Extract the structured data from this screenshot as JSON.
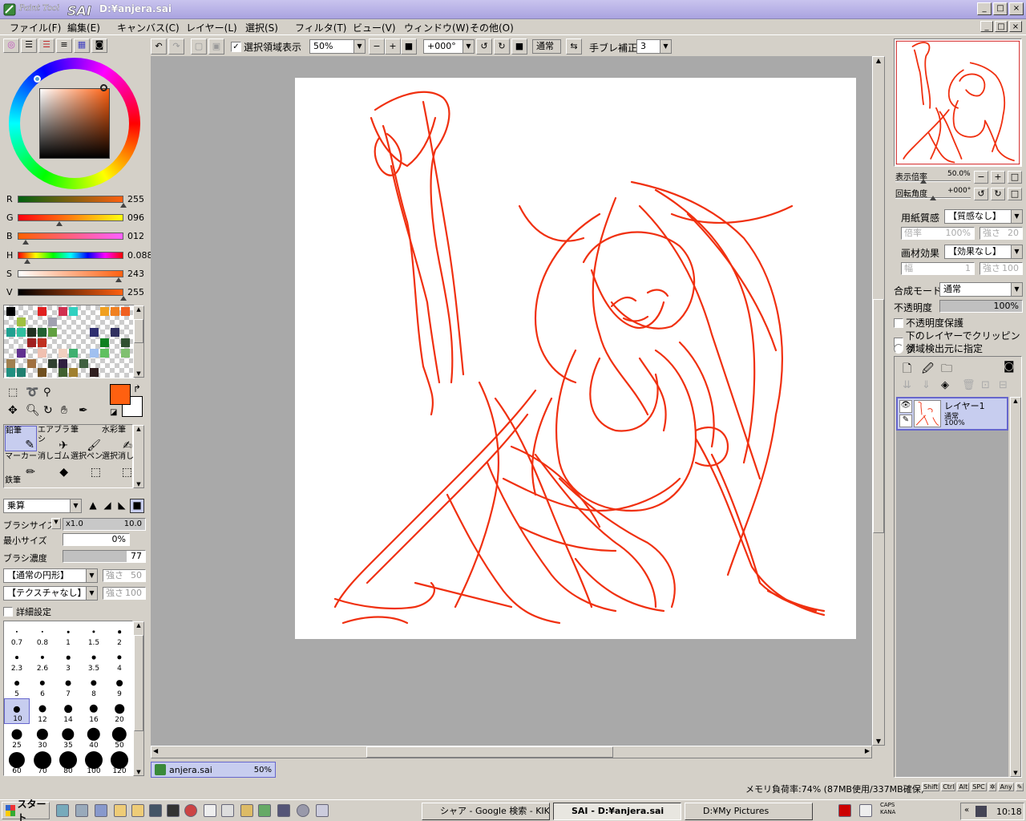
{
  "window": {
    "app_logo": "PaintTool SAI",
    "title": "D:¥anjera.sai"
  },
  "menu": [
    "ファイル(F)",
    "編集(E)",
    "キャンバス(C)",
    "レイヤー(L)",
    "選択(S)",
    "フィルタ(T)",
    "ビュー(V)",
    "ウィンドウ(W)",
    "その他(O)"
  ],
  "toolbar": {
    "selection_show_label": "選択領域表示",
    "selection_show_checked": true,
    "zoom": "50%",
    "rotation": "+000°",
    "blend": "通常",
    "stabilizer_label": "手ブレ補正",
    "stabilizer_value": "3"
  },
  "color": {
    "current_hex": "#ff6010",
    "sliders": [
      {
        "label": "R",
        "value": "255",
        "level": 1.0
      },
      {
        "label": "G",
        "value": "096",
        "level": 0.376
      },
      {
        "label": "B",
        "value": "012",
        "level": 0.047
      },
      {
        "label": "H",
        "value": "0.088",
        "level": 0.06
      },
      {
        "label": "S",
        "value": "243",
        "level": 0.95
      },
      {
        "label": "V",
        "value": "255",
        "level": 1.0
      }
    ]
  },
  "tools": [
    {
      "label": "鉛筆",
      "icon": "pencil-icon",
      "selected": true
    },
    {
      "label": "エアブラシ",
      "icon": "airbrush-icon"
    },
    {
      "label": "筆",
      "icon": "brush-icon"
    },
    {
      "label": "水彩筆",
      "icon": "watercolor-icon"
    },
    {
      "label": "マーカー",
      "icon": "marker-icon"
    },
    {
      "label": "消しゴム",
      "icon": "eraser-icon"
    },
    {
      "label": "選択ペン",
      "icon": "select-pen-icon"
    },
    {
      "label": "選択消し",
      "icon": "select-eraser-icon"
    },
    {
      "label": "鉄筆",
      "icon": "stylus-icon"
    }
  ],
  "brush": {
    "blend_mode": "乗算",
    "size_label": "ブラシサイズ",
    "size_multiplier": "x1.0",
    "size_value": "10.0",
    "min_size_label": "最小サイズ",
    "min_size_value": "0%",
    "density_label": "ブラシ濃度",
    "density_value": "77",
    "shape": "【通常の円形】",
    "shape_strength": "強さ",
    "shape_strength_value": "50",
    "texture": "【テクスチャなし】",
    "texture_strength": "強さ",
    "texture_strength_value": "100",
    "detail_label": "詳細設定"
  },
  "brush_sizes": [
    "0.7",
    "0.8",
    "1",
    "1.5",
    "2",
    "2.3",
    "2.6",
    "3",
    "3.5",
    "4",
    "5",
    "6",
    "7",
    "8",
    "9",
    "10",
    "12",
    "14",
    "16",
    "20",
    "25",
    "30",
    "35",
    "40",
    "50",
    "60",
    "70",
    "80",
    "100",
    "120"
  ],
  "document_tab": {
    "name": "anjera.sai",
    "zoom": "50%"
  },
  "navigator": {
    "zoom_label": "表示倍率",
    "zoom_value": "50.0%",
    "angle_label": "回転角度",
    "angle_value": "+000°"
  },
  "paper": {
    "texture_label": "用紙質感",
    "texture_value": "【質感なし】",
    "scale_label": "倍率",
    "scale_value": "100%",
    "strength_label": "強さ",
    "strength_value": "20",
    "effect_label": "画材効果",
    "effect_value": "【効果なし】",
    "width_label": "幅",
    "width_value": "1",
    "effect_strength_label": "強さ",
    "effect_strength_value": "100"
  },
  "layer_props": {
    "mode_label": "合成モード",
    "mode_value": "通常",
    "opacity_label": "不透明度",
    "opacity_value": "100%",
    "protect_label": "不透明度保護",
    "clip_label": "下のレイヤーでクリッピング",
    "source_label": "領域検出元に指定"
  },
  "layers": [
    {
      "name": "レイヤー1",
      "mode": "通常",
      "opacity": "100%"
    }
  ],
  "status": {
    "memory": "メモリ負荷率:74% (87MB使用/337MB確保)",
    "keys": [
      "Shift",
      "Ctrl",
      "Alt",
      "SPC",
      "Any"
    ]
  },
  "taskbar": {
    "start": "スタート",
    "tasks": [
      {
        "label": "シャア - Google 検索 - KIKI",
        "active": false
      },
      {
        "label": "SAI - D:¥anjera.sai",
        "active": true
      },
      {
        "label": "D:¥My Pictures",
        "active": false
      }
    ],
    "caps": "CAPS",
    "kana": "KANA",
    "clock": "10:18"
  }
}
